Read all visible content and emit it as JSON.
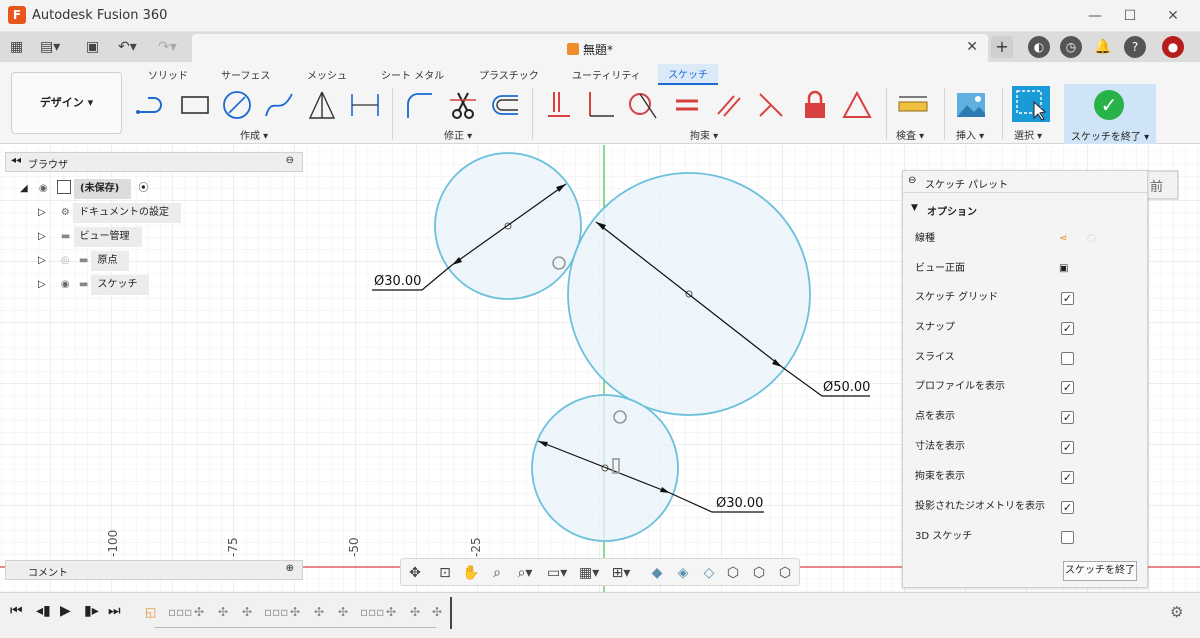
{
  "window": {
    "title": "Autodesk Fusion 360",
    "app_icon_letter": "F",
    "minimize": "—",
    "maximize": "☐",
    "close": "✕"
  },
  "document": {
    "tab_title": "無題*",
    "tab_close": "✕",
    "add_tab": "+"
  },
  "ribbon": {
    "workspace": "デザイン ▾",
    "tabs": [
      "ソリッド",
      "サーフェス",
      "メッシュ",
      "シート メタル",
      "プラスチック",
      "ユーティリティ",
      "スケッチ"
    ],
    "active_tab": "スケッチ",
    "groups": {
      "create": "作成 ▾",
      "modify": "修正 ▾",
      "constraints": "拘束 ▾",
      "inspect": "検査 ▾",
      "insert": "挿入 ▾",
      "select": "選択 ▾",
      "finish": "スケッチを終了 ▾"
    }
  },
  "browser": {
    "title": "ブラウザ",
    "root": "(未保存)",
    "items": [
      "ドキュメントの設定",
      "ビュー管理",
      "原点",
      "スケッチ"
    ]
  },
  "comments": {
    "title": "コメント"
  },
  "canvas": {
    "dimensions": [
      "Ø30.00",
      "Ø50.00",
      "Ø30.00"
    ],
    "ruler_labels": [
      "-100",
      "-75",
      "-50",
      "-25"
    ],
    "viewcube_face": "前"
  },
  "palette": {
    "title": "スケッチ パレット",
    "options_header": "オプション",
    "rows": [
      {
        "label": "線種",
        "type": "icon"
      },
      {
        "label": "ビュー正面",
        "type": "icon"
      },
      {
        "label": "スケッチ グリッド",
        "checked": true
      },
      {
        "label": "スナップ",
        "checked": true
      },
      {
        "label": "スライス",
        "checked": false
      },
      {
        "label": "プロファイルを表示",
        "checked": true
      },
      {
        "label": "点を表示",
        "checked": true
      },
      {
        "label": "寸法を表示",
        "checked": true
      },
      {
        "label": "拘束を表示",
        "checked": true
      },
      {
        "label": "投影されたジオメトリを表示",
        "checked": true
      },
      {
        "label": "3D スケッチ",
        "checked": false
      }
    ],
    "finish_button": "スケッチを終了"
  },
  "colors": {
    "accent": "#1a6bd1",
    "circle_stroke": "#6cc0dc",
    "circle_fill": "#eaf4fb",
    "axis_green": "#3ec43e",
    "axis_red": "#d94040",
    "finish_green": "#27b24a"
  }
}
